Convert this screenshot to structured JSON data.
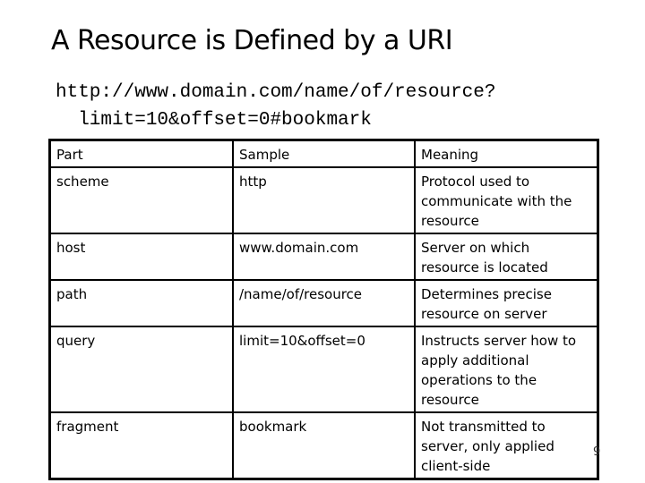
{
  "slide": {
    "title": "A Resource is Defined by a URI",
    "url_line1": "http://www.domain.com/name/of/resource?",
    "url_line2": "  limit=10&offset=0#bookmark",
    "page_number": "9"
  },
  "table": {
    "headers": [
      "Part",
      "Sample",
      "Meaning"
    ],
    "rows": [
      {
        "part": "scheme",
        "sample": "http",
        "meaning": "Protocol used to communicate with the resource",
        "h": 72
      },
      {
        "part": "host",
        "sample": "www.domain.com",
        "meaning": "Server on which resource is located",
        "h": 50
      },
      {
        "part": "path",
        "sample": "/name/of/resource",
        "meaning": "Determines precise resource on server",
        "h": 50
      },
      {
        "part": "query",
        "sample": "limit=10&offset=0",
        "meaning": "Instructs server how to apply additional operations to the resource",
        "h": 93
      },
      {
        "part": "fragment",
        "sample": "bookmark",
        "meaning": "Not transmitted to server, only applied client-side",
        "h": 73
      }
    ]
  }
}
